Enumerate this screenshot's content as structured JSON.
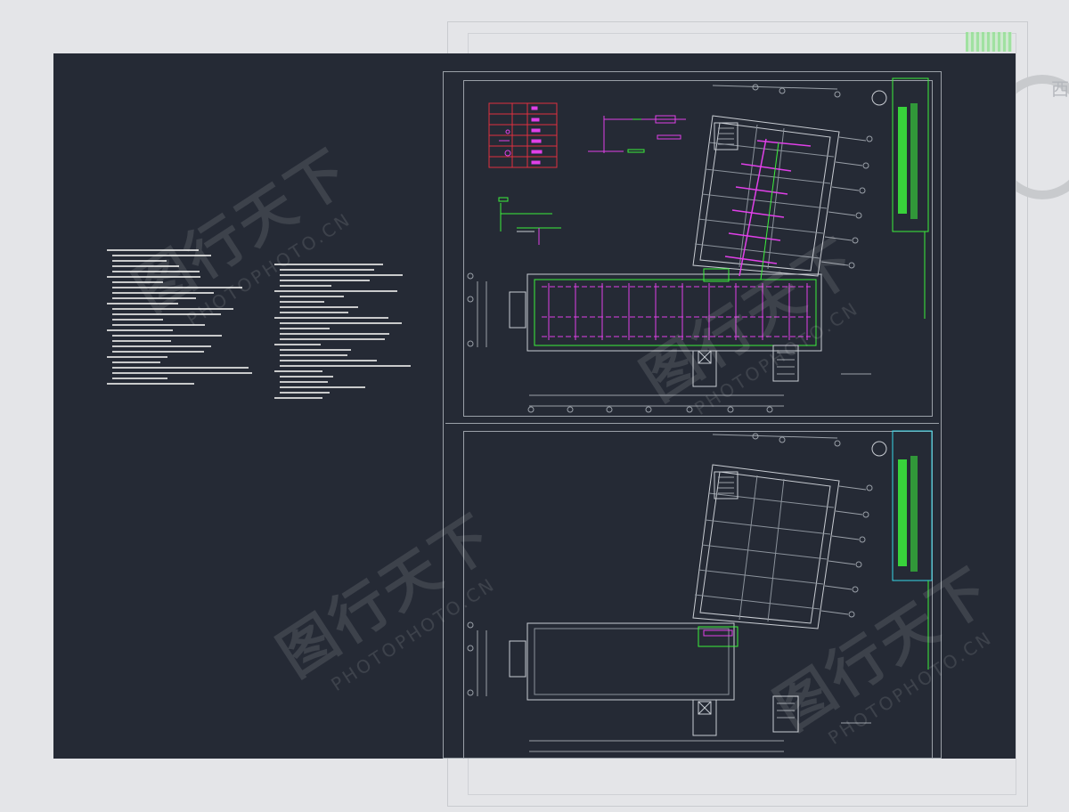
{
  "ghost": {
    "char": "西"
  },
  "watermark": {
    "chinese": "图行天下",
    "english": "PHOTOPHOTO.CN"
  },
  "notes": {
    "title": "",
    "left_lines": 26,
    "right_lines": 26
  },
  "sheets": [
    {
      "id": "upper",
      "label": ""
    },
    {
      "id": "lower",
      "label": ""
    }
  ],
  "colors": {
    "background": "#e4e5e8",
    "canvas": "#252a35",
    "line": "#c8ccd2",
    "magenta": "#e040e8",
    "green": "#3cf03c",
    "cyan": "#38d8e8",
    "red": "#e03040"
  }
}
